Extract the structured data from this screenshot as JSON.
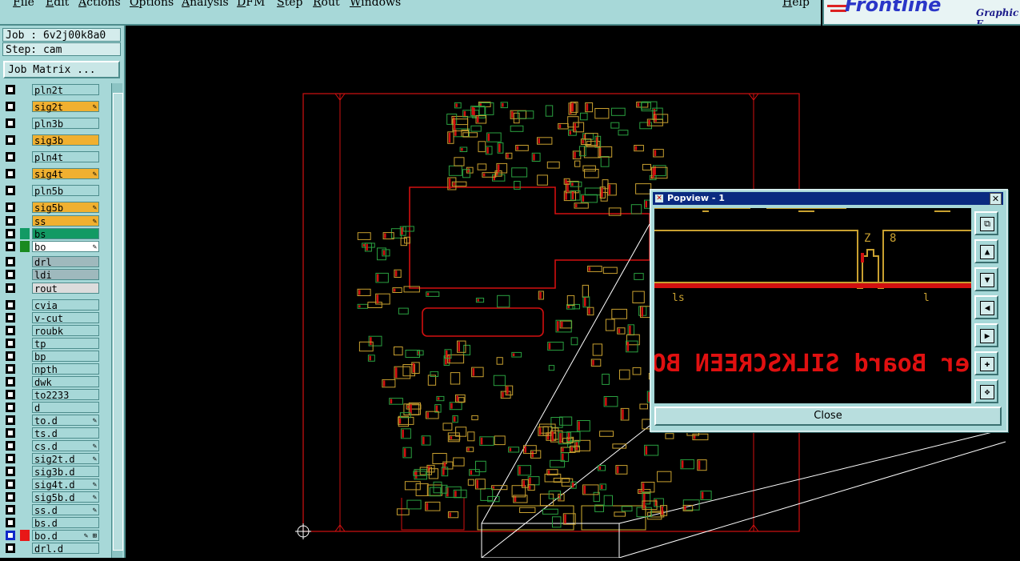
{
  "menu": [
    "File",
    "Edit",
    "Actions",
    "Options",
    "Analysis",
    "DFM",
    "Step",
    "Rout",
    "Windows"
  ],
  "help": "Help",
  "logo": {
    "brand": "Frontline",
    "tagline": "Graphic E"
  },
  "job": {
    "job_label": "Job : 6v2j00k8a0",
    "step_label": "Step: cam",
    "matrix_button": "Job Matrix ..."
  },
  "layers": [
    {
      "name": "pln2t",
      "color": "#a7d8d8",
      "flag": ""
    },
    {
      "name": "sig2t",
      "color": "#f0b030",
      "flag": "✎"
    },
    {
      "name": "pln3b",
      "color": "#a7d8d8",
      "flag": ""
    },
    {
      "name": "sig3b",
      "color": "#f0b030",
      "flag": ""
    },
    {
      "name": "pln4t",
      "color": "#a7d8d8",
      "flag": ""
    },
    {
      "name": "sig4t",
      "color": "#f0b030",
      "flag": "✎"
    },
    {
      "name": "pln5b",
      "color": "#a7d8d8",
      "flag": ""
    },
    {
      "name": "sig5b",
      "color": "#f0b030",
      "flag": "✎"
    },
    {
      "name": "ss",
      "color": "#f0b030",
      "flag": "✎"
    },
    {
      "name": "bs",
      "color": "#129a64",
      "flag": ""
    },
    {
      "name": "bo",
      "color": "#ffffff",
      "flag": "✎"
    },
    {
      "name": "drl",
      "color": "#9fb9bd",
      "flag": ""
    },
    {
      "name": "ldi",
      "color": "#9fb9bd",
      "flag": ""
    },
    {
      "name": "rout",
      "color": "#dcdcdc",
      "flag": ""
    },
    {
      "name": "cvia",
      "color": "#a7d8d8",
      "flag": ""
    },
    {
      "name": "v-cut",
      "color": "#a7d8d8",
      "flag": ""
    },
    {
      "name": "roubk",
      "color": "#a7d8d8",
      "flag": ""
    },
    {
      "name": "tp",
      "color": "#a7d8d8",
      "flag": ""
    },
    {
      "name": "bp",
      "color": "#a7d8d8",
      "flag": ""
    },
    {
      "name": "npth",
      "color": "#a7d8d8",
      "flag": ""
    },
    {
      "name": "dwk",
      "color": "#a7d8d8",
      "flag": ""
    },
    {
      "name": "to2233",
      "color": "#a7d8d8",
      "flag": ""
    },
    {
      "name": "d",
      "color": "#a7d8d8",
      "flag": ""
    },
    {
      "name": "to.d",
      "color": "#a7d8d8",
      "flag": "✎"
    },
    {
      "name": "ts.d",
      "color": "#a7d8d8",
      "flag": ""
    },
    {
      "name": "cs.d",
      "color": "#a7d8d8",
      "flag": "✎"
    },
    {
      "name": "sig2t.d",
      "color": "#a7d8d8",
      "flag": "✎"
    },
    {
      "name": "sig3b.d",
      "color": "#a7d8d8",
      "flag": ""
    },
    {
      "name": "sig4t.d",
      "color": "#a7d8d8",
      "flag": "✎"
    },
    {
      "name": "sig5b.d",
      "color": "#a7d8d8",
      "flag": "✎"
    },
    {
      "name": "ss.d",
      "color": "#a7d8d8",
      "flag": "✎"
    },
    {
      "name": "bs.d",
      "color": "#a7d8d8",
      "flag": ""
    },
    {
      "name": "bo.d",
      "color": "#a7d8d8",
      "flag": "✎ ⊞"
    },
    {
      "name": "drl.d",
      "color": "#a7d8d8",
      "flag": ""
    }
  ],
  "popview": {
    "title": "Popview - 1",
    "close_x": "✕",
    "close_label": "Close",
    "silkscreen_text": "er Board SILKSCREEN BOT",
    "pad_labels": [
      "Z",
      "8",
      "ls",
      "l"
    ],
    "tool_icons": [
      "zoom-fit-icon",
      "pan-up-icon",
      "pan-down-icon",
      "pan-left-icon",
      "pan-right-icon",
      "zoom-in-icon",
      "zoom-out-icon"
    ]
  }
}
